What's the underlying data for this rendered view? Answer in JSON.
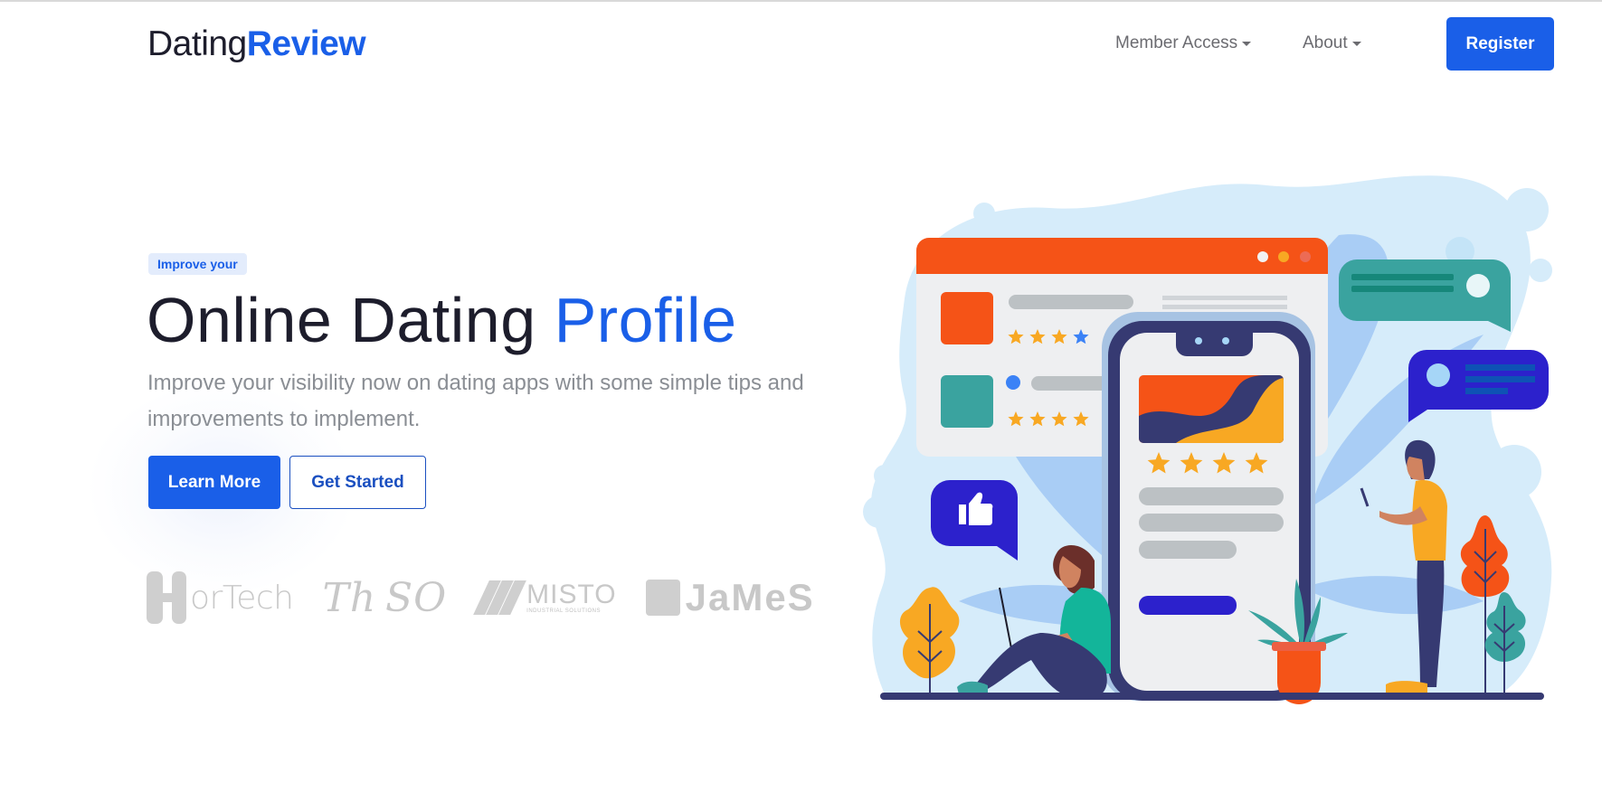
{
  "navbar": {
    "logo": {
      "part1": "Dating",
      "part2": "Review"
    },
    "menu": [
      {
        "label": "Member Access",
        "icon": "caret-down-icon"
      },
      {
        "label": "About",
        "icon": "caret-down-icon"
      }
    ],
    "register_label": "Register"
  },
  "hero": {
    "badge": "Improve your",
    "headline": {
      "plain": "Online Dating ",
      "accent": "Profile"
    },
    "lead": "Improve your visibility now on dating apps with some simple tips and improvements to implement.",
    "primary_button": "Learn More",
    "secondary_button": "Get Started"
  },
  "client_logos": [
    {
      "name": "HorTech",
      "text": "orTech"
    },
    {
      "name": "ThASO",
      "text": "Th SO"
    },
    {
      "name": "MISTO",
      "text": "MISTO",
      "subtitle": "INDUSTRIAL SOLUTIONS"
    },
    {
      "name": "JaMeS",
      "text": "JaMeS"
    }
  ],
  "illustration": {
    "subject": "online dating review app illustration",
    "browser_ratings": [
      4,
      4
    ],
    "phone_rating": 4
  },
  "colors": {
    "brand": "#1a5fe8",
    "text_dark": "#1d1d2c",
    "muted": "#8a8e94",
    "orange": "#f55317",
    "teal": "#3aa39f",
    "indigo": "#2c21cc",
    "yellow": "#f8a823",
    "navy": "#363a72",
    "sky": "#d6ecfa"
  }
}
